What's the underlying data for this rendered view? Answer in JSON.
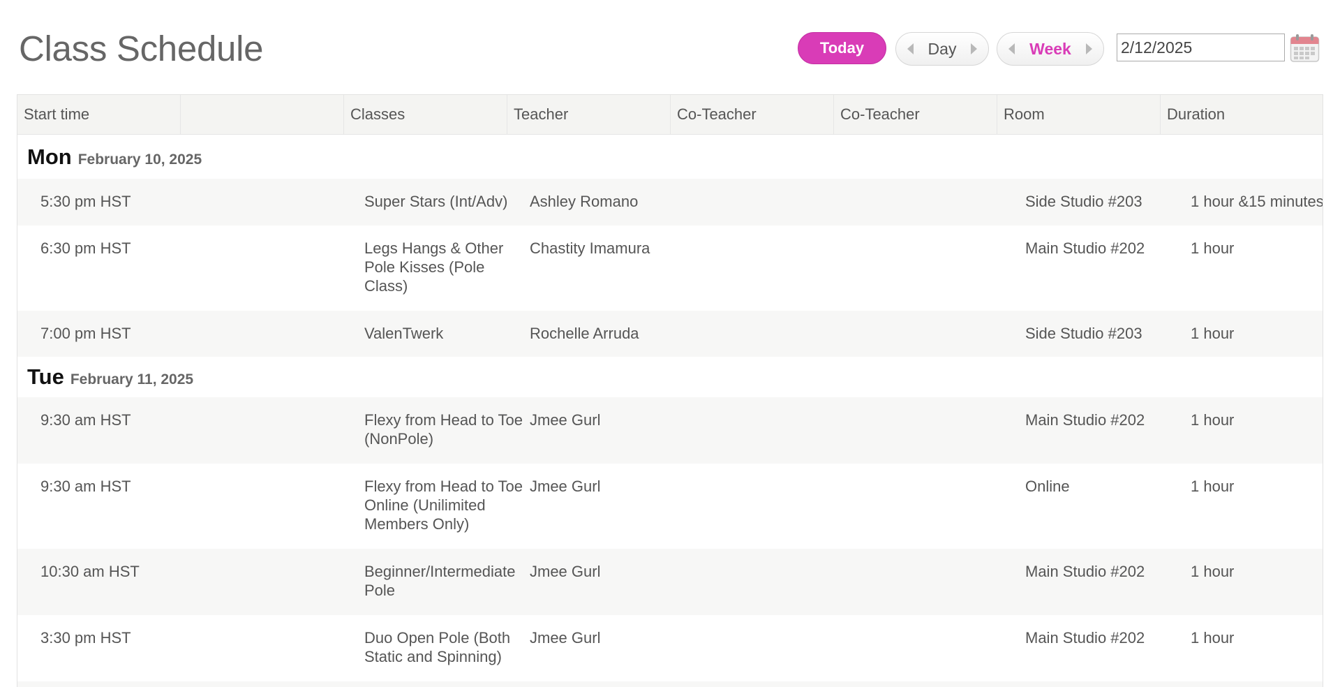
{
  "header": {
    "title": "Class Schedule",
    "today_label": "Today",
    "day_label": "Day",
    "week_label": "Week",
    "date_value": "2/12/2025"
  },
  "colors": {
    "accent": "#d93cb7",
    "header_bg": "#f4f4f2",
    "row_alt_bg": "#f7f7f6"
  },
  "table": {
    "columns": [
      "Start time",
      "",
      "Classes",
      "Teacher",
      "Co-Teacher",
      "Co-Teacher",
      "Room",
      "Duration"
    ]
  },
  "days": [
    {
      "name": "Mon",
      "date": "February 10, 2025",
      "classes": [
        {
          "time": "5:30 pm HST",
          "class": "Super Stars (Int/Adv)",
          "teacher": "Ashley Romano",
          "room": "Side Studio #203",
          "duration": "1 hour &15 minutes"
        },
        {
          "time": "6:30 pm HST",
          "class": "Legs Hangs & Other Pole Kisses (Pole Class)",
          "teacher": "Chastity Imamura",
          "room": "Main Studio #202",
          "duration": "1 hour"
        },
        {
          "time": "7:00 pm HST",
          "class": "ValenTwerk",
          "teacher": "Rochelle Arruda",
          "room": "Side Studio #203",
          "duration": "1 hour"
        }
      ]
    },
    {
      "name": "Tue",
      "date": "February 11, 2025",
      "classes": [
        {
          "time": "9:30 am HST",
          "class": "Flexy from Head to Toe (NonPole)",
          "teacher": "Jmee Gurl",
          "room": "Main Studio #202",
          "duration": "1 hour"
        },
        {
          "time": "9:30 am HST",
          "class": "Flexy from Head to Toe Online (Unilimited Members Only)",
          "teacher": "Jmee Gurl",
          "room": "Online",
          "duration": "1 hour"
        },
        {
          "time": "10:30 am HST",
          "class": "Beginner/Intermediate Pole",
          "teacher": "Jmee Gurl",
          "room": "Main Studio #202",
          "duration": "1 hour"
        },
        {
          "time": "3:30 pm HST",
          "class": "Duo Open Pole (Both Static and Spinning)",
          "teacher": "Jmee Gurl",
          "room": "Main Studio #202",
          "duration": "1 hour"
        }
      ]
    }
  ]
}
